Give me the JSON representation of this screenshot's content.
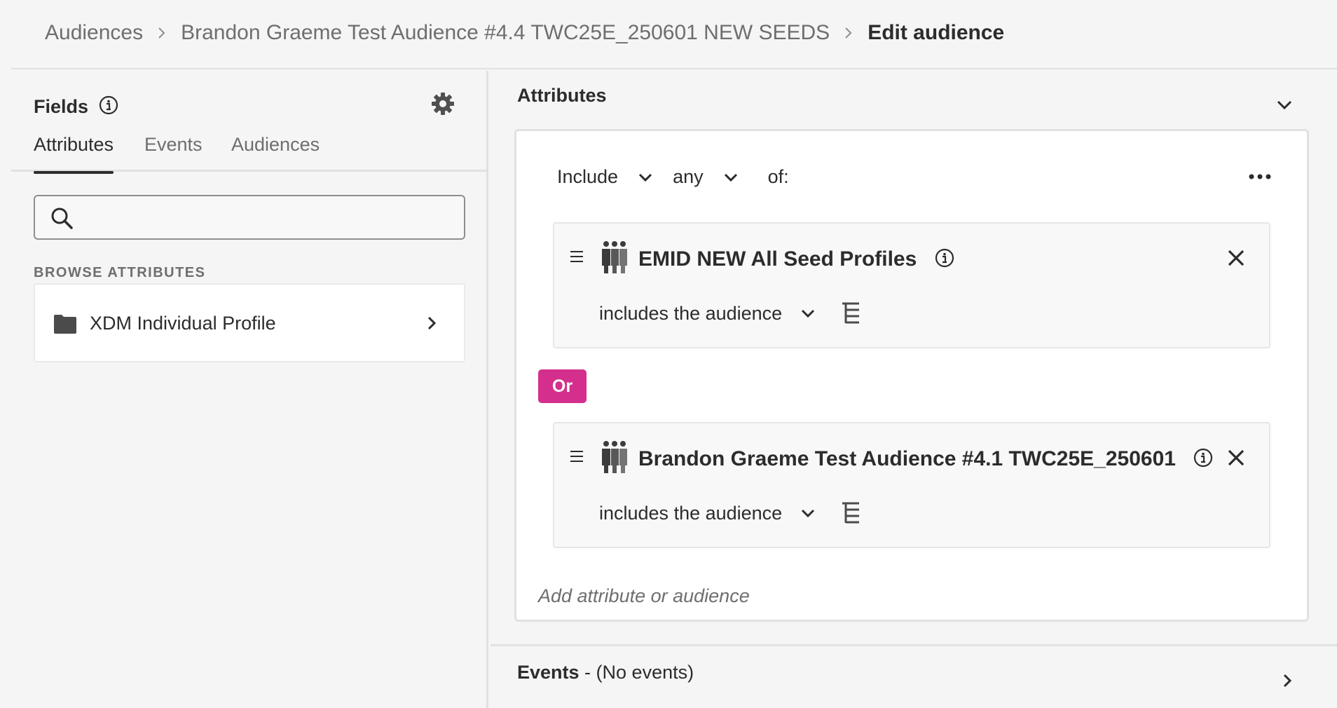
{
  "breadcrumb": {
    "items": [
      "Audiences",
      "Brandon Graeme Test Audience #4.4 TWC25E_250601 NEW SEEDS"
    ],
    "current": "Edit audience"
  },
  "fields_panel": {
    "title": "Fields",
    "tabs": [
      {
        "label": "Attributes",
        "active": true
      },
      {
        "label": "Events",
        "active": false
      },
      {
        "label": "Audiences",
        "active": false
      }
    ],
    "search": {
      "value": "",
      "placeholder": ""
    },
    "browse_label": "BROWSE ATTRIBUTES",
    "browse_items": [
      {
        "label": "XDM Individual Profile",
        "icon": "folder-icon"
      }
    ]
  },
  "attributes_section": {
    "title": "Attributes",
    "logic": {
      "include_label": "Include",
      "match_label": "any",
      "suffix": "of:"
    },
    "rules": [
      {
        "name": "EMID NEW All Seed Profiles",
        "operator": "includes the audience"
      },
      {
        "name": "Brandon Graeme Test Audience #4.1 TWC25E_250601",
        "operator": "includes the audience"
      }
    ],
    "connector": "Or",
    "add_placeholder": "Add attribute or audience"
  },
  "events_section": {
    "title": "Events",
    "subtitle": " - (No events)"
  },
  "colors": {
    "or_badge": "#d42f8c",
    "text_primary": "#2c2c2c",
    "text_secondary": "#6e6e6e"
  }
}
